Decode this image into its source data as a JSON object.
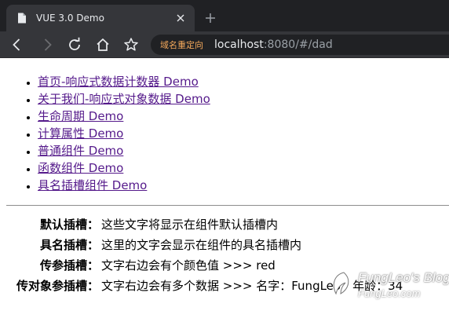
{
  "browser": {
    "tab": {
      "title": "VUE 3.0 Demo",
      "favicon": "page-icon"
    },
    "toolbar": {
      "icons": [
        "back-arrow-icon",
        "forward-arrow-icon",
        "reload-icon",
        "home-icon",
        "star-icon"
      ],
      "omnibox_chip": "域名重定向",
      "url_host": "localhost",
      "url_rest": ":8080/#/dad"
    },
    "colors": {
      "tabstrip": "#202124",
      "toolbar": "#35363a",
      "chip": "#f5a95b"
    }
  },
  "nav_links": [
    {
      "label": "首页-响应式数据计数器 Demo"
    },
    {
      "label": "关于我们-响应式对象数据 Demo"
    },
    {
      "label": "生命周期 Demo"
    },
    {
      "label": "计算属性 Demo"
    },
    {
      "label": "普通组件 Demo"
    },
    {
      "label": "函数组件 Demo"
    },
    {
      "label": "具名插槽组件 Demo"
    }
  ],
  "slots": [
    {
      "label": "默认插槽：",
      "value": "这些文字将显示在组件默认插槽内"
    },
    {
      "label": "具名插槽：",
      "value": "这里的文字会显示在组件的具名插槽内"
    },
    {
      "label": "传参插槽：",
      "value": "文字右边会有个颜色值 >>> red"
    },
    {
      "label": "传对象参插槽：",
      "value": "文字右边会有多个数据 >>> 名字：FungLeo，年龄：34"
    }
  ],
  "watermark": {
    "title": "FungLeo's Blog",
    "url": "FungLeo.com"
  },
  "link_color": "#551a8b"
}
